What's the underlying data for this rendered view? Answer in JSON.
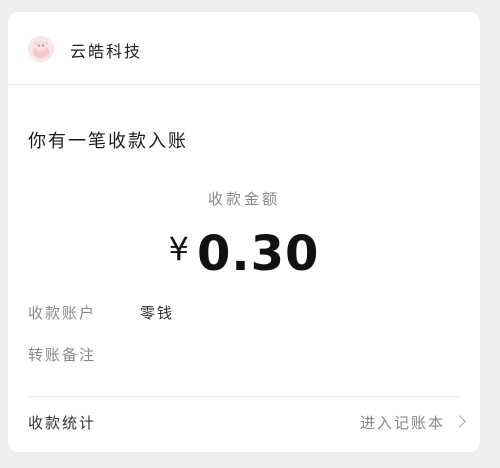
{
  "merchant": {
    "name": "云皓科技",
    "avatar_icon": "pink-cartoon-avatar-icon"
  },
  "notice": {
    "title": "你有一笔收款入账"
  },
  "payment": {
    "amount_label": "收款金额",
    "currency_symbol": "¥",
    "amount": "0.30"
  },
  "details": {
    "account_label": "收款账户",
    "account_value": "零钱",
    "remark_label": "转账备注",
    "remark_value": ""
  },
  "footer": {
    "stats_label": "收款统计",
    "ledger_link": "进入记账本",
    "ledger_icon": "chevron-right-icon"
  }
}
